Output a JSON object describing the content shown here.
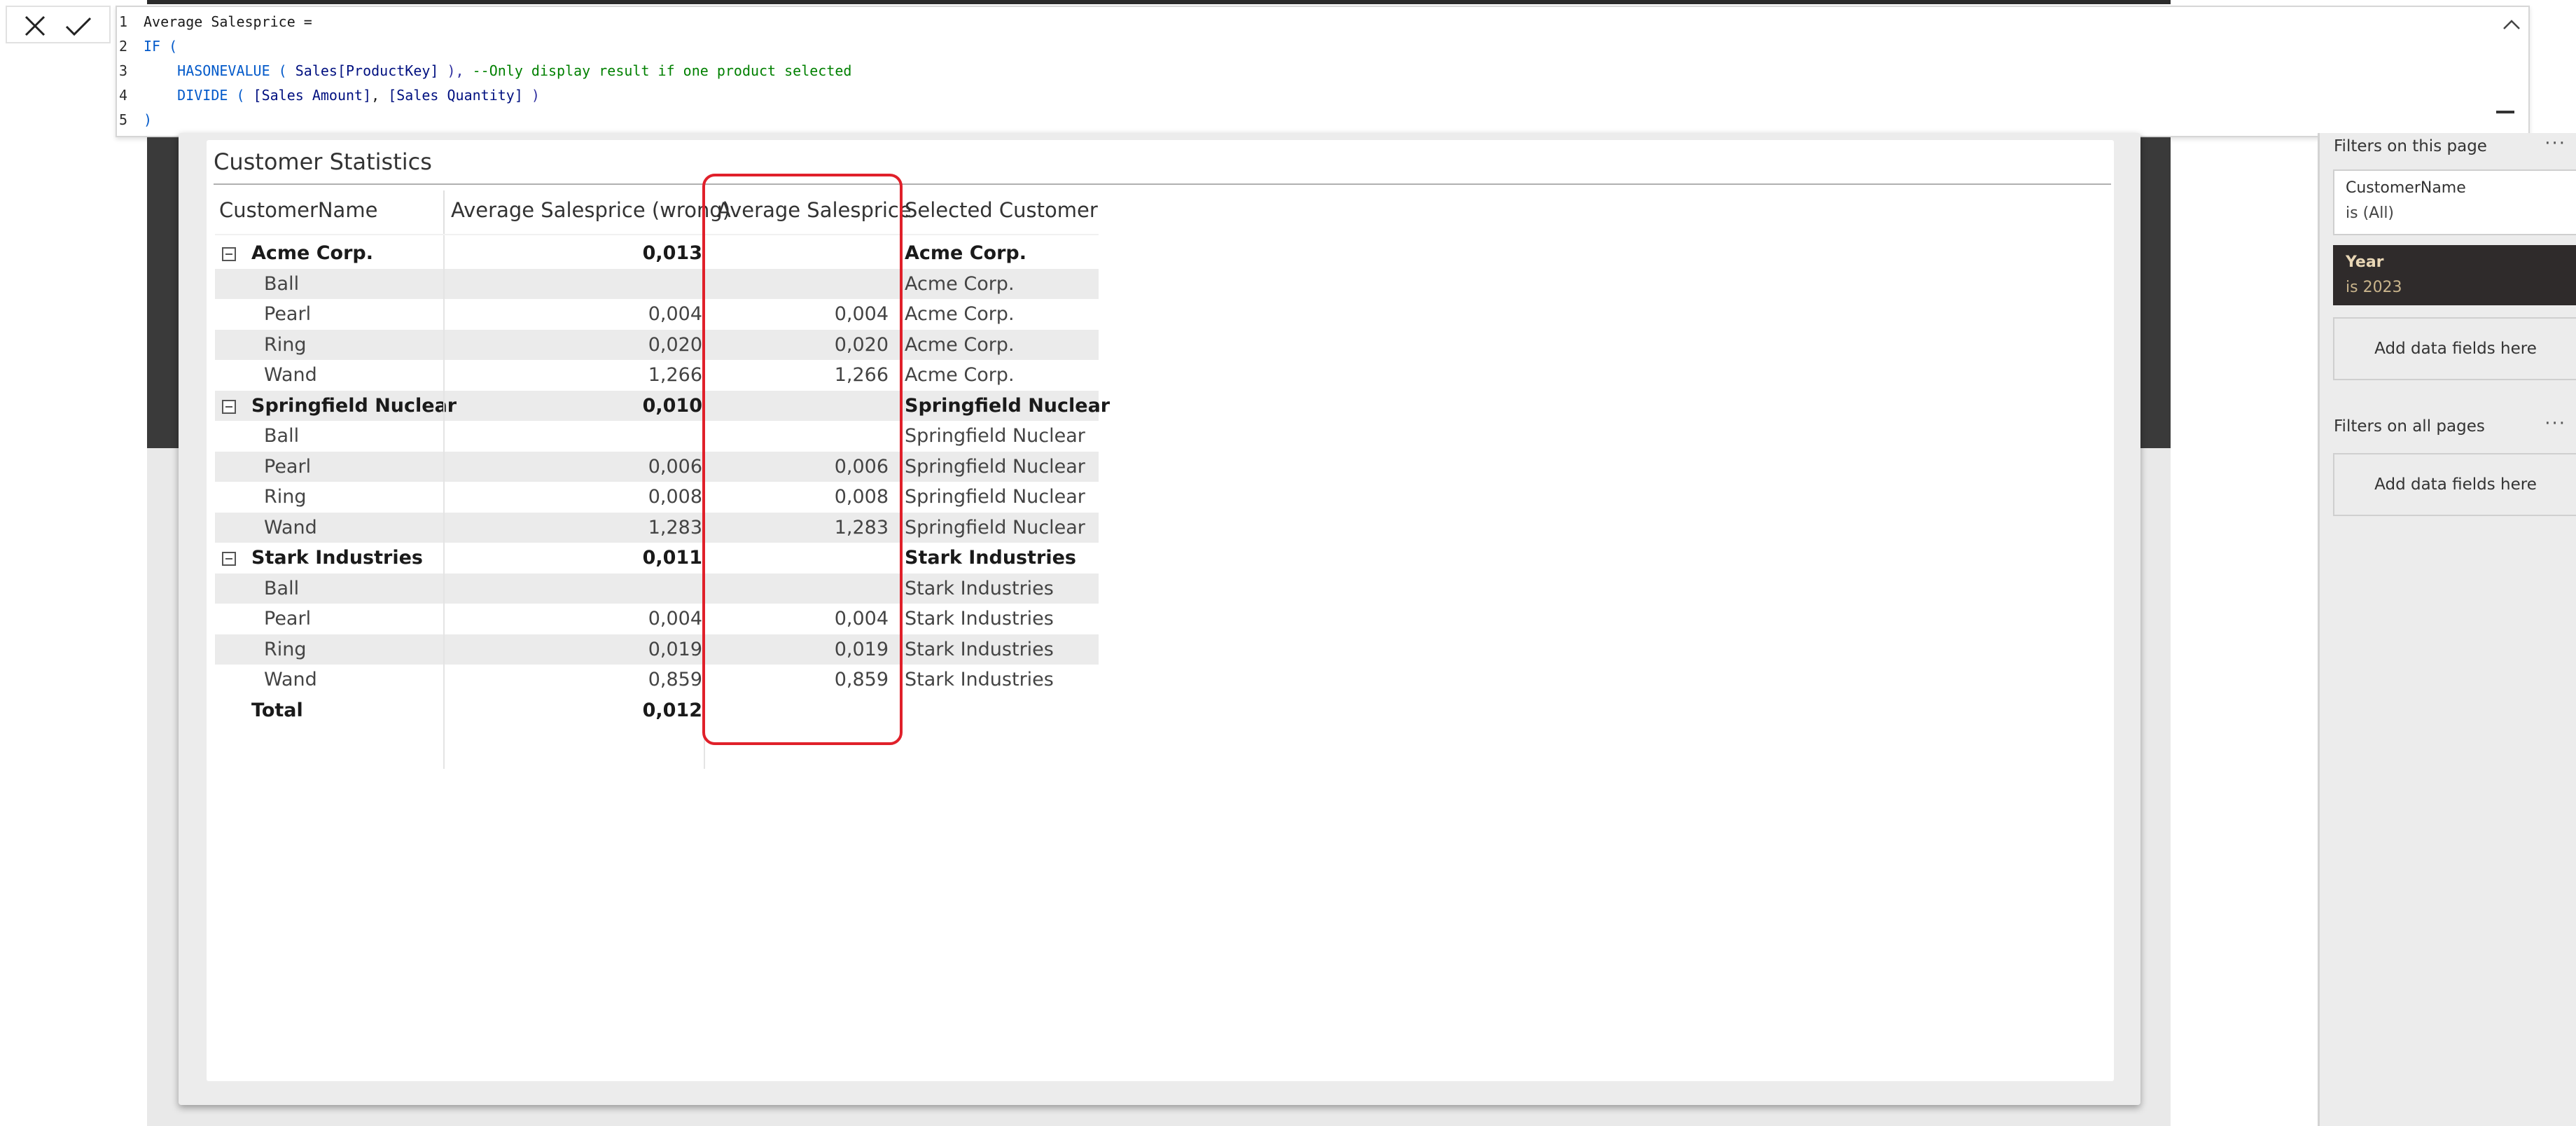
{
  "formula": {
    "lines": [
      {
        "num": "1",
        "parts": [
          {
            "t": "Average Salesprice =",
            "c": "k-tok"
          }
        ]
      },
      {
        "num": "2",
        "parts": [
          {
            "t": "IF (",
            "c": "k-kw"
          }
        ]
      },
      {
        "num": "3",
        "parts": [
          {
            "t": "    HASONEVALUE ( ",
            "c": "k-kw"
          },
          {
            "t": "Sales[ProductKey]",
            "c": "k-col"
          },
          {
            "t": " ), ",
            "c": "k-par"
          },
          {
            "t": "--Only display result if one product selected",
            "c": "k-cm"
          }
        ]
      },
      {
        "num": "4",
        "parts": [
          {
            "t": "    DIVIDE ( ",
            "c": "k-kw"
          },
          {
            "t": "[Sales Amount]",
            "c": "k-col"
          },
          {
            "t": ", ",
            "c": "k-tok"
          },
          {
            "t": "[Sales Quantity]",
            "c": "k-col"
          },
          {
            "t": " )",
            "c": "k-par"
          }
        ]
      },
      {
        "num": "5",
        "parts": [
          {
            "t": ")",
            "c": "k-kw"
          }
        ]
      }
    ]
  },
  "visual": {
    "title": "Customer Statistics",
    "headers": {
      "name": "CustomerName",
      "wrong": "Average Salesprice (wrong)",
      "avg": "Average Salesprice",
      "selected": "Selected Customer"
    },
    "rows": [
      {
        "type": "group",
        "name": "Acme Corp.",
        "wrong": "0,013",
        "avg": "",
        "sel": "Acme Corp.",
        "alt": false
      },
      {
        "type": "child",
        "name": "Ball",
        "wrong": "",
        "avg": "",
        "sel": "Acme Corp.",
        "alt": true
      },
      {
        "type": "child",
        "name": "Pearl",
        "wrong": "0,004",
        "avg": "0,004",
        "sel": "Acme Corp.",
        "alt": false
      },
      {
        "type": "child",
        "name": "Ring",
        "wrong": "0,020",
        "avg": "0,020",
        "sel": "Acme Corp.",
        "alt": true
      },
      {
        "type": "child",
        "name": "Wand",
        "wrong": "1,266",
        "avg": "1,266",
        "sel": "Acme Corp.",
        "alt": false
      },
      {
        "type": "group",
        "name": "Springfield Nuclear",
        "wrong": "0,010",
        "avg": "",
        "sel": "Springfield Nuclear",
        "alt": true
      },
      {
        "type": "child",
        "name": "Ball",
        "wrong": "",
        "avg": "",
        "sel": "Springfield Nuclear",
        "alt": false
      },
      {
        "type": "child",
        "name": "Pearl",
        "wrong": "0,006",
        "avg": "0,006",
        "sel": "Springfield Nuclear",
        "alt": true
      },
      {
        "type": "child",
        "name": "Ring",
        "wrong": "0,008",
        "avg": "0,008",
        "sel": "Springfield Nuclear",
        "alt": false
      },
      {
        "type": "child",
        "name": "Wand",
        "wrong": "1,283",
        "avg": "1,283",
        "sel": "Springfield Nuclear",
        "alt": true
      },
      {
        "type": "group",
        "name": "Stark Industries",
        "wrong": "0,011",
        "avg": "",
        "sel": "Stark Industries",
        "alt": false
      },
      {
        "type": "child",
        "name": "Ball",
        "wrong": "",
        "avg": "",
        "sel": "Stark Industries",
        "alt": true
      },
      {
        "type": "child",
        "name": "Pearl",
        "wrong": "0,004",
        "avg": "0,004",
        "sel": "Stark Industries",
        "alt": false
      },
      {
        "type": "child",
        "name": "Ring",
        "wrong": "0,019",
        "avg": "0,019",
        "sel": "Stark Industries",
        "alt": true
      },
      {
        "type": "child",
        "name": "Wand",
        "wrong": "0,859",
        "avg": "0,859",
        "sel": "Stark Industries",
        "alt": false
      },
      {
        "type": "total",
        "name": "Total",
        "wrong": "0,012",
        "avg": "",
        "sel": "",
        "alt": false
      }
    ]
  },
  "filters": {
    "page_heading": "Filters on this page",
    "all_heading": "Filters on all pages",
    "more_glyph": "···",
    "customer_filter": {
      "field": "CustomerName",
      "value": "is (All)"
    },
    "year_filter": {
      "field": "Year",
      "value": "is 2023"
    },
    "add_fields_label": "Add data fields here"
  },
  "colors": {
    "highlight": "#e0202a",
    "canvas_dark": "#3a3a3a"
  },
  "icons": [
    "cancel-icon",
    "commit-check-icon",
    "chevron-up-icon",
    "collapse-minus-icon",
    "more-options-icon"
  ]
}
